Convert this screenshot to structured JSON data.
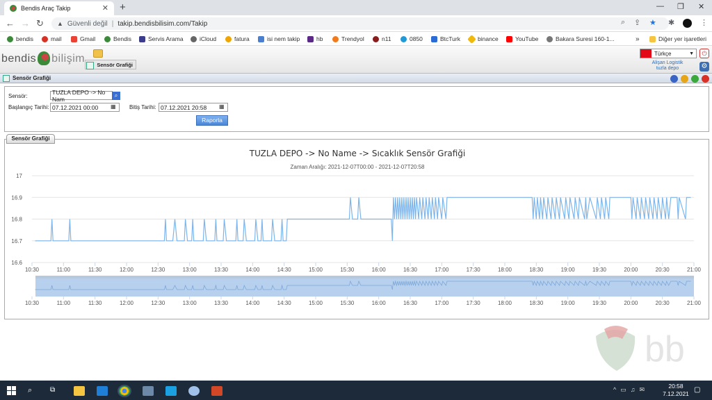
{
  "browser": {
    "tab_title": "Bendis Araç Takip",
    "security_label": "Güvenli değil",
    "url": "takip.bendisbilisim.com/Takip",
    "bookmarks": [
      "bendis",
      "mail",
      "Gmail",
      "Bendis",
      "Servis Arama",
      "iCloud",
      "fatura",
      "isi nem takip",
      "hb",
      "Trendyol",
      "n11",
      "0850",
      "BtcTurk",
      "binance",
      "YouTube",
      "Bakara Suresi 160-1..."
    ],
    "other_bookmarks": "Diğer yer işaretleri",
    "overflow": "»"
  },
  "app": {
    "logo_part1": "bendis",
    "logo_part2": "bilişim",
    "active_tab": "Sensör Grafiği",
    "language": "Türkçe",
    "company_line1": "Alişan Logistik",
    "company_line2": "tuzla depo",
    "panel_title": "Sensör Grafiği"
  },
  "form": {
    "sensor_label": "Sensör:",
    "sensor_value": "TUZLA DEPO -> No Nam",
    "start_label": "Başlangıç Tarihi:",
    "start_value": "07.12.2021 00:00",
    "end_label": "Bitiş Tarihi:",
    "end_value": "07.12.2021 20:58",
    "report_button": "Raporla"
  },
  "chart_section_tab": "Sensör Grafiği",
  "chart_data": {
    "type": "line",
    "title": "TUZLA DEPO -> No Name -> Sıcaklık Sensör Grafiği",
    "subtitle": "Zaman Aralığı: 2021-12-07T00:00 - 2021-12-07T20:58",
    "ylim": [
      16.6,
      17.0
    ],
    "yticks": [
      "17",
      "16.9",
      "16.8",
      "16.7",
      "16.6"
    ],
    "xticks": [
      "10:30",
      "11:00",
      "11:30",
      "12:00",
      "12:30",
      "13:00",
      "13:30",
      "14:00",
      "14:30",
      "15:00",
      "15:30",
      "16:00",
      "16:30",
      "17:00",
      "17:30",
      "18:00",
      "18:30",
      "19:00",
      "19:30",
      "20:00",
      "20:30",
      "21:00"
    ],
    "xlim": [
      "10:30",
      "21:00"
    ],
    "grid": true,
    "series": [
      {
        "color": "#7cb5ec",
        "points": [
          [
            "10:33",
            16.7
          ],
          [
            "10:48",
            16.7
          ],
          [
            "10:49",
            16.8
          ],
          [
            "10:50",
            16.7
          ],
          [
            "11:05",
            16.7
          ],
          [
            "11:06",
            16.8
          ],
          [
            "11:07",
            16.7
          ],
          [
            "12:36",
            16.7
          ],
          [
            "12:37",
            16.8
          ],
          [
            "12:38",
            16.7
          ],
          [
            "12:44",
            16.7
          ],
          [
            "12:46",
            16.8
          ],
          [
            "12:48",
            16.7
          ],
          [
            "12:55",
            16.7
          ],
          [
            "12:56",
            16.8
          ],
          [
            "12:58",
            16.7
          ],
          [
            "13:02",
            16.7
          ],
          [
            "13:03",
            16.8
          ],
          [
            "13:04",
            16.7
          ],
          [
            "13:13",
            16.7
          ],
          [
            "13:14",
            16.8
          ],
          [
            "13:16",
            16.7
          ],
          [
            "13:24",
            16.7
          ],
          [
            "13:25",
            16.8
          ],
          [
            "13:26",
            16.7
          ],
          [
            "13:32",
            16.7
          ],
          [
            "13:33",
            16.8
          ],
          [
            "13:35",
            16.7
          ],
          [
            "13:44",
            16.7
          ],
          [
            "13:45",
            16.8
          ],
          [
            "13:46",
            16.7
          ],
          [
            "13:51",
            16.7
          ],
          [
            "13:52",
            16.8
          ],
          [
            "13:54",
            16.7
          ],
          [
            "14:02",
            16.7
          ],
          [
            "14:03",
            16.8
          ],
          [
            "14:05",
            16.7
          ],
          [
            "14:08",
            16.7
          ],
          [
            "14:09",
            16.8
          ],
          [
            "14:10",
            16.7
          ],
          [
            "14:18",
            16.7
          ],
          [
            "14:19",
            16.8
          ],
          [
            "14:21",
            16.7
          ],
          [
            "14:27",
            16.7
          ],
          [
            "14:28",
            16.8
          ],
          [
            "14:29",
            16.7
          ],
          [
            "14:32",
            16.7
          ],
          [
            "14:33",
            16.8
          ],
          [
            "15:32",
            16.8
          ],
          [
            "15:33",
            16.9
          ],
          [
            "15:35",
            16.8
          ],
          [
            "15:40",
            16.8
          ],
          [
            "15:41",
            16.9
          ],
          [
            "15:43",
            16.8
          ],
          [
            "16:12",
            16.8
          ],
          [
            "16:13",
            16.7
          ],
          [
            "16:14",
            16.9
          ],
          [
            "16:15",
            16.8
          ],
          [
            "16:16",
            16.9
          ],
          [
            "16:17",
            16.8
          ],
          [
            "16:18",
            16.9
          ],
          [
            "16:19",
            16.8
          ],
          [
            "16:20",
            16.9
          ],
          [
            "16:21",
            16.8
          ],
          [
            "16:22",
            16.9
          ],
          [
            "16:23",
            16.8
          ],
          [
            "16:24",
            16.9
          ],
          [
            "16:25",
            16.8
          ],
          [
            "16:26",
            16.9
          ],
          [
            "16:27",
            16.8
          ],
          [
            "16:28",
            16.9
          ],
          [
            "16:29",
            16.8
          ],
          [
            "16:30",
            16.9
          ],
          [
            "16:31",
            16.8
          ],
          [
            "16:32",
            16.9
          ],
          [
            "16:33",
            16.8
          ],
          [
            "16:34",
            16.9
          ],
          [
            "16:35",
            16.8
          ],
          [
            "16:36",
            16.9
          ],
          [
            "16:38",
            16.8
          ],
          [
            "16:39",
            16.9
          ],
          [
            "16:41",
            16.8
          ],
          [
            "16:42",
            16.9
          ],
          [
            "16:44",
            16.8
          ],
          [
            "16:45",
            16.9
          ],
          [
            "16:47",
            16.8
          ],
          [
            "16:48",
            16.9
          ],
          [
            "16:50",
            16.8
          ],
          [
            "16:51",
            16.9
          ],
          [
            "16:53",
            16.8
          ],
          [
            "16:54",
            16.9
          ],
          [
            "16:56",
            16.8
          ],
          [
            "16:57",
            16.9
          ],
          [
            "17:00",
            16.8
          ],
          [
            "17:01",
            16.9
          ],
          [
            "17:04",
            16.8
          ],
          [
            "17:05",
            16.9
          ],
          [
            "18:26",
            16.9
          ],
          [
            "18:27",
            16.8
          ],
          [
            "18:28",
            16.9
          ],
          [
            "18:30",
            16.8
          ],
          [
            "18:31",
            16.9
          ],
          [
            "18:33",
            16.8
          ],
          [
            "18:34",
            16.9
          ],
          [
            "18:36",
            16.8
          ],
          [
            "18:37",
            16.9
          ],
          [
            "18:40",
            16.8
          ],
          [
            "18:41",
            16.9
          ],
          [
            "18:44",
            16.8
          ],
          [
            "18:45",
            16.9
          ],
          [
            "18:48",
            16.8
          ],
          [
            "18:49",
            16.9
          ],
          [
            "18:52",
            16.8
          ],
          [
            "18:53",
            16.9
          ],
          [
            "18:57",
            16.8
          ],
          [
            "18:58",
            16.9
          ],
          [
            "19:01",
            16.8
          ],
          [
            "19:02",
            16.9
          ],
          [
            "19:06",
            16.8
          ],
          [
            "19:07",
            16.9
          ],
          [
            "19:10",
            16.8
          ],
          [
            "19:11",
            16.9
          ],
          [
            "19:16",
            16.8
          ],
          [
            "19:17",
            16.9
          ],
          [
            "19:18",
            16.8
          ],
          [
            "19:21",
            16.9
          ],
          [
            "19:27",
            16.8
          ],
          [
            "19:28",
            16.9
          ],
          [
            "19:31",
            16.8
          ],
          [
            "19:32",
            16.9
          ],
          [
            "19:35",
            16.8
          ],
          [
            "19:36",
            16.9
          ],
          [
            "19:39",
            16.8
          ],
          [
            "19:40",
            16.9
          ],
          [
            "20:00",
            16.9
          ],
          [
            "20:01",
            16.8
          ],
          [
            "20:02",
            16.9
          ],
          [
            "20:05",
            16.8
          ],
          [
            "20:06",
            16.9
          ],
          [
            "20:09",
            16.8
          ],
          [
            "20:10",
            16.9
          ],
          [
            "20:13",
            16.8
          ],
          [
            "20:14",
            16.9
          ],
          [
            "20:17",
            16.8
          ],
          [
            "20:18",
            16.9
          ],
          [
            "20:21",
            16.8
          ],
          [
            "20:22",
            16.9
          ],
          [
            "20:25",
            16.8
          ],
          [
            "20:26",
            16.9
          ],
          [
            "20:29",
            16.8
          ],
          [
            "20:30",
            16.9
          ],
          [
            "20:33",
            16.8
          ],
          [
            "20:34",
            16.9
          ],
          [
            "20:36",
            16.8
          ],
          [
            "20:38",
            16.9
          ],
          [
            "20:44",
            16.9
          ],
          [
            "20:45",
            16.8
          ],
          [
            "20:46",
            16.9
          ],
          [
            "20:52",
            16.8
          ],
          [
            "20:53",
            16.9
          ],
          [
            "20:57",
            16.9
          ]
        ]
      }
    ]
  },
  "taskbar": {
    "time": "20:58",
    "date": "7.12.2021"
  },
  "watermark": "bb",
  "colors": {
    "accent": "#3b6fd2",
    "series": "#7cb5ec",
    "taskbar": "#1c2a3a"
  }
}
